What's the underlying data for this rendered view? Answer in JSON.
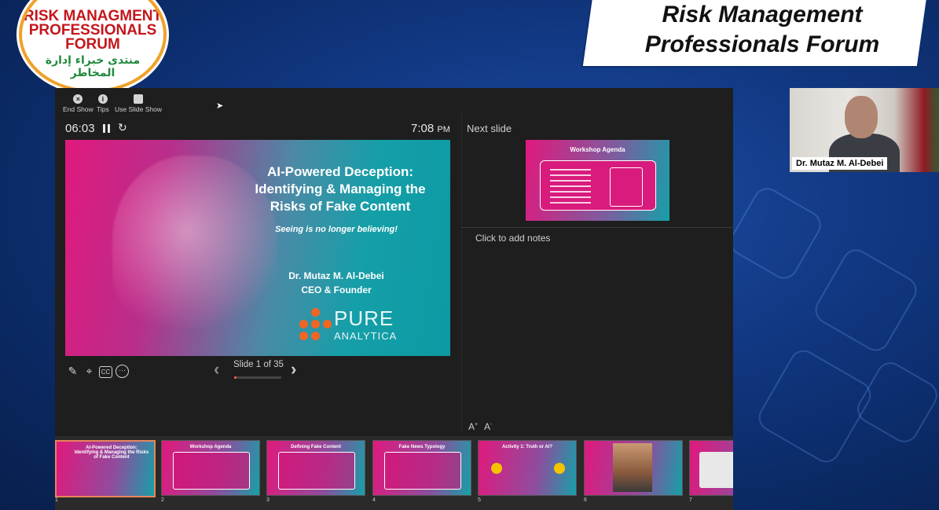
{
  "header": {
    "logo_text_en": "RISK MANAGMENT PROFESSIONALS FORUM",
    "logo_text_ar": "منتدى خبراء إدارة المخاطر",
    "banner_line1": "Risk Management",
    "banner_line2": "Professionals Forum"
  },
  "toolbar": {
    "end_show": "End Show",
    "tips": "Tips",
    "use_slide_show": "Use Slide Show"
  },
  "presenter": {
    "elapsed": "06:03",
    "clock": "7:08",
    "clock_suffix": "PM",
    "next_slide_label": "Next slide",
    "notes_placeholder": "Click to add notes",
    "slide_counter": "Slide 1 of 35",
    "progress_fraction": 0.0286
  },
  "current_slide": {
    "title_line1": "AI-Powered Deception:",
    "title_line2": "Identifying & Managing the",
    "title_line3": "Risks of Fake Content",
    "subtitle": "Seeing is no longer believing!",
    "presenter": "Dr. Mutaz M. Al-Debei",
    "role": "CEO & Founder",
    "brand_line1": "PURE",
    "brand_line2": "ANALYTICA"
  },
  "next_slide": {
    "title": "Workshop Agenda",
    "items": [
      "Introduction & Scope",
      "Defining Fake Content",
      "Deepfake Technology",
      "Threats & Impact",
      "Detection & Mitigation",
      "Policy & Ethics",
      "Future Trends & Conclusion"
    ]
  },
  "thumbnails": [
    {
      "num": "1",
      "title": "AI-Powered Deception: Identifying & Managing the Risks of Fake Content"
    },
    {
      "num": "2",
      "title": "Workshop Agenda"
    },
    {
      "num": "3",
      "title": "Defining Fake Content"
    },
    {
      "num": "4",
      "title": "Fake News Typology"
    },
    {
      "num": "5",
      "title": "Activity 1: Truth or AI?"
    },
    {
      "num": "6",
      "title": ""
    },
    {
      "num": "7",
      "title": ""
    }
  ],
  "webcam": {
    "name": "Dr. Mutaz M. Al-Debei"
  }
}
